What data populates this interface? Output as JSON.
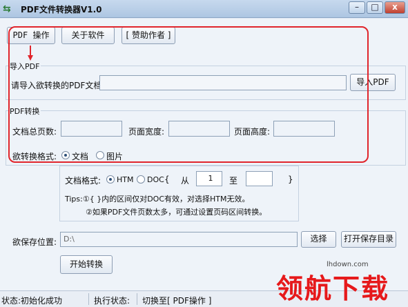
{
  "window": {
    "title": "PDF文件转换器V1.0",
    "icon": "arrows-icon",
    "controls": {
      "minimize": "–",
      "maximize": "□",
      "close": "x"
    }
  },
  "toolbar": {
    "pdf_ops": "PDF 操作",
    "about": "关于软件",
    "sponsor": "[ 赞助作者 ]"
  },
  "import_section": {
    "legend": "导入PDF",
    "prompt": "请导入欲转换的PDF文档:",
    "path_value": "",
    "import_button": "导入PDF"
  },
  "convert_section": {
    "legend": "PDF转换",
    "total_pages_label": "文档总页数:",
    "total_pages_value": "",
    "page_width_label": "页面宽度:",
    "page_width_value": "",
    "page_height_label": "页面高度:",
    "page_height_value": "",
    "format_label": "欲转换格式:",
    "format_options": [
      "文档",
      "图片"
    ],
    "format_selected": "文档"
  },
  "doc_options": {
    "format_label": "文档格式:",
    "options": [
      "HTM",
      "DOC"
    ],
    "selected": "HTM",
    "brace_open": "{",
    "from_label": "从",
    "from_value": "1",
    "to_label": "至",
    "to_value": "",
    "brace_close": "}",
    "tip_line1": "Tips:①{ }内的区间仅对DOC有效，对选择HTM无效。",
    "tip_line2": "②如果PDF文件页数太多，可通过设置页码区间转换。"
  },
  "save": {
    "label": "欲保存位置:",
    "path": "D:\\",
    "choose_button": "选择",
    "open_dir_button": "打开保存目录"
  },
  "start_button": "开始转换",
  "status_bar": {
    "state": "状态:初始化成功",
    "exec_label": "执行状态:",
    "exec_value": "切换至[ PDF操作 ]"
  },
  "watermark": {
    "site": "lhdown.com",
    "text": "领航下载"
  },
  "colors": {
    "highlight": "#e0242b",
    "title_bar": "#adc6e2",
    "window_bg": "#eef3f9"
  }
}
